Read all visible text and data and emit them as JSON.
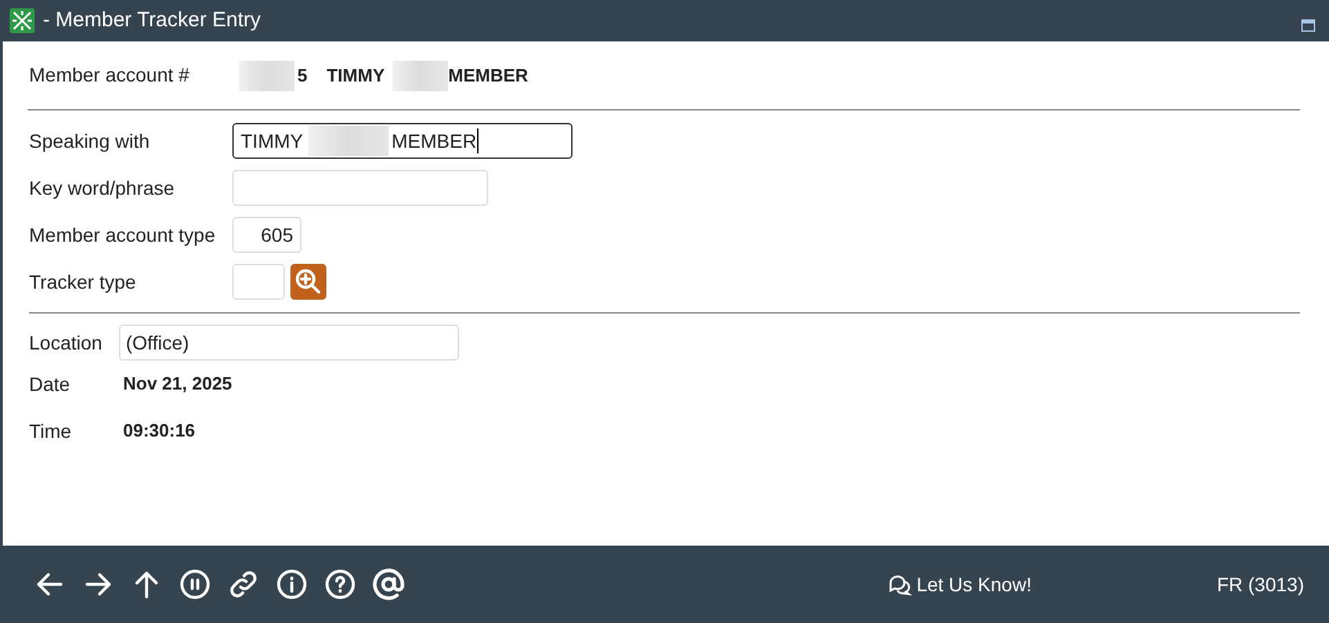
{
  "window": {
    "title": "- Member Tracker Entry"
  },
  "account": {
    "label": "Member account #",
    "number_tail": "5",
    "first_name": "TIMMY",
    "last_name": "MEMBER"
  },
  "fields": [
    {
      "kind": "name",
      "label": "Speaking with",
      "first": "TIMMY",
      "last": "MEMBER",
      "focused": true
    },
    {
      "kind": "text",
      "label": "Key word/phrase",
      "focused": false
    },
    {
      "kind": "number",
      "label": "Member account type",
      "value": "605",
      "focused": false
    },
    {
      "kind": "lookup",
      "label": "Tracker type",
      "focused": false
    }
  ],
  "location": {
    "label": "Location",
    "value": "(Office)"
  },
  "info": [
    {
      "label": "Date",
      "value": "Nov 21, 2025"
    },
    {
      "label": "Time",
      "value": "09:30:16"
    }
  ],
  "footer": {
    "feedback": "Let Us Know!",
    "code": "FR (3013)"
  }
}
